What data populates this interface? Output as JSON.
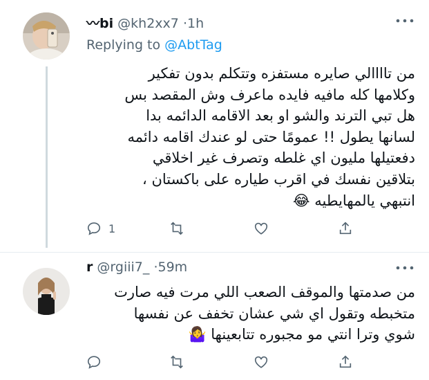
{
  "tweets": [
    {
      "display_name": "〰bi",
      "handle": "@kh2xx7",
      "separator": "·",
      "time": "1h",
      "replying_prefix": "Replying to ",
      "replying_to": "@AbtTag",
      "text": "من تاااالي صايره مستفزه وتتكلم بدون تفكير\nوكلامها كله مافيه فايده ماعرف وش المقصد بس\nهل تبي الترند والشو او بعد الاقامه الدائمه بدا\nلسانها يطول !! عمومًا حتى لو عندك اقامه دائمه\nدفعتيلها مليون اي غلطه وتصرف غير اخلاقي\nبتلاقين نفسك في اقرب طياره على باكستان ،\nانتبهي يالمهايطيه 😂",
      "reply_count": "1",
      "more_icon": "more-dots-icon"
    },
    {
      "display_name": "r",
      "handle": "@rgiii7_",
      "separator": "·",
      "time": "59m",
      "text": "من صدمتها والموقف الصعب اللي مرت فيه صارت\nمتخبطه وتقول اي شي عشان تخفف عن نفسها\nشوي وترا انتي مو مجبوره تتابعينها 🤷‍♀️",
      "more_icon": "more-dots-icon"
    }
  ],
  "icons": {
    "reply": "reply-icon",
    "retweet": "retweet-icon",
    "like": "heart-icon",
    "share": "share-icon"
  },
  "colors": {
    "text": "#0f1419",
    "secondary": "#536471",
    "link": "#1d9bf0",
    "thread_line": "#cfd9de",
    "divider": "#e6ecf0"
  }
}
